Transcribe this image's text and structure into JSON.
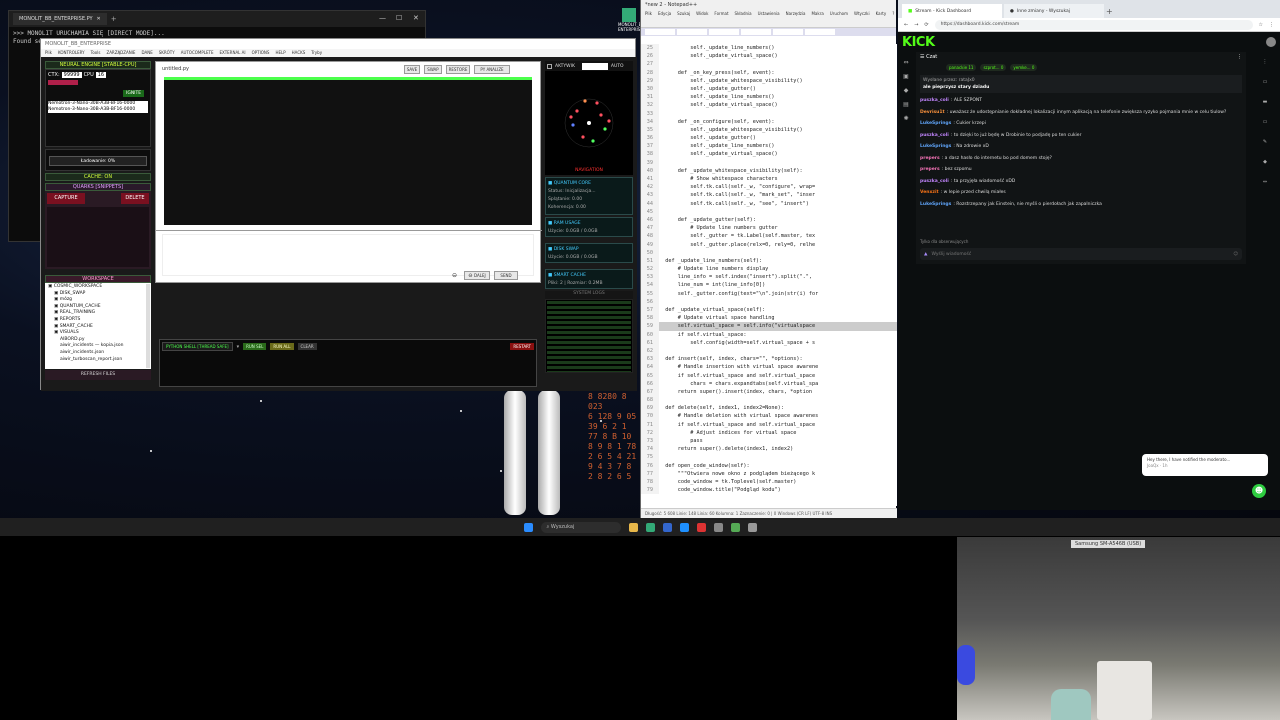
{
  "terminal": {
    "tab_title": "MONOLIT_BB_ENTERPRISE.PY",
    "lines": [
      ">>> MONOLIT URUCHAMIA SIĘ [DIRECT MODE]...",
      "Found se..."
    ]
  },
  "desktop_label": "MONOLIT_BB\nENTERPRISE",
  "app": {
    "title": "MONOLIT_BB_ENTERPRISE",
    "menu": [
      "Plik",
      "KONTROLERY",
      "Tools",
      "ZARZĄDZANIE",
      "DANE",
      "SKRÓTY",
      "AUTOCOMPLETE",
      "EXTERNAL AI",
      "OPTIONS",
      "HELP",
      "HACKS",
      "Tryby"
    ],
    "left": {
      "engine_title": "NEURAL ENGINE [STABLE-CPU]",
      "ctx_label": "CTX:",
      "ctx_value": "99999",
      "cpu_label": "CPU",
      "cpu_value": "16",
      "ignite": "IGNITE",
      "models": [
        "Nemotron-3-Nano-30B-A3B-BF16-0000",
        "Nemotron-3-Nano-30B-A3B-BF16-0000"
      ],
      "loading": "Ładowanie: 0%",
      "cache": "CACHE: ON",
      "quarks": "QUARKS [SNIPPETS]",
      "capture": "CAPTURE",
      "delete": "DELETE",
      "workspace": "WORKSPACE",
      "tree": [
        "COSMIC_WORKSPACE",
        "DISK_SWAP",
        "mózg",
        "QUANTUM_CACHE",
        "REAL_TRAINING",
        "REPORTS",
        "SMART_CACHE",
        "VISUALS",
        "AIBORD.py",
        "aiwir_incidents — kopia.json",
        "aiwir_incidents.json",
        "aiwir_turboscan_report.json"
      ],
      "refresh": "REFRESH FILES"
    },
    "editor": {
      "filename": "untitled.py",
      "buttons": [
        "SAVE",
        "SWAP",
        "RESTORE",
        "PY ANALIZE"
      ],
      "dalej": "DALEJ",
      "send": "SEND"
    },
    "shell": {
      "title": "PYTHON SHELL [THREAD SAFE]",
      "buttons": [
        "RUN SEL",
        "RUN ALL",
        "CLEAR"
      ],
      "restart": "RESTART"
    },
    "right": {
      "active": "AKTYWIK",
      "auto": "AUTO",
      "label": "NAVIGATION",
      "quantum": "QUANTUM CORE",
      "status": "Status: Inicjalizacja...",
      "splatanie": "Splątanie: 0.00",
      "koherencja": "Koherencja: 0.00",
      "ram": "RAM USAGE",
      "ram_val": "Użycie: 0.0GB / 0.0GB",
      "disk": "DISK SWAP",
      "disk_val": "Użycie: 0.0GB / 0.0GB",
      "smart": "SMART CACHE",
      "smart_val": "Pliki: 2 | Rozmiar: 0.2MB",
      "logs": "SYSTEM LOGS"
    }
  },
  "notepad": {
    "title": "*new 2 - Notepad++",
    "menu": [
      "Plik",
      "Edycja",
      "Szukaj",
      "Widok",
      "Format",
      "Składnia",
      "Ustawienia",
      "Narzędzia",
      "Makra",
      "Uruchom",
      "Wtyczki",
      "Karty",
      "?"
    ],
    "lines": [
      {
        "n": "25",
        "t": "          self._update_line_numbers()"
      },
      {
        "n": "26",
        "t": "          self._update_virtual_space()"
      },
      {
        "n": "27",
        "t": ""
      },
      {
        "n": "28",
        "t": "      def _on_key_press(self, event):"
      },
      {
        "n": "29",
        "t": "          self._update_whitespace_visibility()"
      },
      {
        "n": "30",
        "t": "          self._update_gutter()"
      },
      {
        "n": "31",
        "t": "          self._update_line_numbers()"
      },
      {
        "n": "32",
        "t": "          self._update_virtual_space()"
      },
      {
        "n": "33",
        "t": ""
      },
      {
        "n": "34",
        "t": "      def _on_configure(self, event):"
      },
      {
        "n": "35",
        "t": "          self._update_whitespace_visibility()"
      },
      {
        "n": "36",
        "t": "          self._update_gutter()"
      },
      {
        "n": "37",
        "t": "          self._update_line_numbers()"
      },
      {
        "n": "38",
        "t": "          self._update_virtual_space()"
      },
      {
        "n": "39",
        "t": ""
      },
      {
        "n": "40",
        "t": "      def _update_whitespace_visibility(self):"
      },
      {
        "n": "41",
        "t": "          # Show whitespace characters"
      },
      {
        "n": "42",
        "t": "          self.tk.call(self._w, \"configure\", wrap="
      },
      {
        "n": "43",
        "t": "          self.tk.call(self._w, \"mark_set\", \"inser"
      },
      {
        "n": "44",
        "t": "          self.tk.call(self._w, \"see\", \"insert\")"
      },
      {
        "n": "45",
        "t": ""
      },
      {
        "n": "46",
        "t": "      def _update_gutter(self):"
      },
      {
        "n": "47",
        "t": "          # Update line numbers gutter"
      },
      {
        "n": "48",
        "t": "          self._gutter = tk.Label(self.master, tex"
      },
      {
        "n": "49",
        "t": "          self._gutter.place(relx=0, rely=0, relhe"
      },
      {
        "n": "50",
        "t": ""
      },
      {
        "n": "51",
        "t": "  def _update_line_numbers(self):"
      },
      {
        "n": "52",
        "t": "      # Update line numbers display"
      },
      {
        "n": "53",
        "t": "      line_info = self.index(\"insert\").split(\".\","
      },
      {
        "n": "54",
        "t": "      line_num = int(line_info[0])"
      },
      {
        "n": "55",
        "t": "      self._gutter.config(text=\"\\n\".join(str(i) for"
      },
      {
        "n": "56",
        "t": ""
      },
      {
        "n": "57",
        "t": "  def _update_virtual_space(self):"
      },
      {
        "n": "58",
        "t": "      # Update virtual space handling"
      },
      {
        "n": "59",
        "t": "      self.virtual_space = self.info(\"virtualspace"
      },
      {
        "n": "60",
        "t": "      if self.virtual_space:"
      },
      {
        "n": "61",
        "t": "          self.config(width=self.virtual_space + s"
      },
      {
        "n": "62",
        "t": ""
      },
      {
        "n": "63",
        "t": "  def insert(self, index, chars=\"\", *options):"
      },
      {
        "n": "64",
        "t": "      # Handle insertion with virtual space awarene"
      },
      {
        "n": "65",
        "t": "      if self.virtual_space and self.virtual_space"
      },
      {
        "n": "66",
        "t": "          chars = chars.expandtabs(self.virtual_spa"
      },
      {
        "n": "67",
        "t": "      return super().insert(index, chars, *option"
      },
      {
        "n": "68",
        "t": ""
      },
      {
        "n": "69",
        "t": "  def delete(self, index1, index2=None):"
      },
      {
        "n": "70",
        "t": "      # Handle deletion with virtual space awarenes"
      },
      {
        "n": "71",
        "t": "      if self.virtual_space and self.virtual_space"
      },
      {
        "n": "72",
        "t": "          # Adjust indices for virtual space"
      },
      {
        "n": "73",
        "t": "          pass"
      },
      {
        "n": "74",
        "t": "      return super().delete(index1, index2)"
      },
      {
        "n": "75",
        "t": ""
      },
      {
        "n": "76",
        "t": "  def open_code_window(self):"
      },
      {
        "n": "77",
        "t": "      \"\"\"Otwiera nowe okno z podglądem bieżącego k"
      },
      {
        "n": "78",
        "t": "      code_window = tk.Toplevel(self.master)"
      },
      {
        "n": "79",
        "t": "      code_window.title(\"Podgląd kodu\")"
      }
    ],
    "status": "Długość: 5 608   Linie: 148   Linia: 60   Kolumna: 1   Zaznaczenie: 0 | 0     Windows (CR LF)   UTF-8   INS"
  },
  "browser": {
    "tabs": [
      "Stream - Kick Dashboard",
      "Inne zmiany - Wyszukaj"
    ],
    "url": "https://dashboard.kick.com/stream",
    "chat_title": "Czat",
    "pills": [
      "panackie 11",
      "szprot... 0",
      "yemke... 0"
    ],
    "pinned_by": "Wysłane przez: rataJx0",
    "pinned_msg": "ale pieprzysz stary dziadu",
    "messages": [
      {
        "user": "puszka_coli",
        "color": "#c084fc",
        "text": "ALE SZPONT"
      },
      {
        "user": "Devrisu1t",
        "color": "#fb923c",
        "text": "uważasz że udostępnianie dokładnej lokalizacji innym aplikacją na telefonie zwiększa ryzyko pojmania mnie w celu tiulow?"
      },
      {
        "user": "LukeSprings",
        "color": "#60a5fa",
        "text": "Cukier krzepi"
      },
      {
        "user": "puszka_coli",
        "color": "#c084fc",
        "text": "to dzięki to już będę w Drobinie to podjadę po ten cukier"
      },
      {
        "user": "LukeSprings",
        "color": "#60a5fa",
        "text": "Na zdrowie xD"
      },
      {
        "user": "prepers",
        "color": "#f472b6",
        "text": "a dasz hasło do internetu bo pod domem stoję?"
      },
      {
        "user": "prepers",
        "color": "#f472b6",
        "text": "bez szpomu"
      },
      {
        "user": "puszka_coli",
        "color": "#c084fc",
        "text": "ta przyjęła wiadomość xDD"
      },
      {
        "user": "Venxzit",
        "color": "#f97316",
        "text": "w lepie przed chwilą miałes"
      },
      {
        "user": "LukeSprings",
        "color": "#60a5fa",
        "text": "Rozstrzepany jak Einstein, nie myśli o pierdołach jak zapalniczka"
      }
    ],
    "followers_only": "Tylko dla obserwujących",
    "input_placeholder": "Wyślij wiadomość",
    "toast": "Hey there, I have notified the moderato...",
    "toast_sub": "JoaQx · 1h"
  },
  "taskbar": {
    "search": "Wyszukaj"
  },
  "camera": {
    "device": "Samsung SM-A546B (USB)"
  }
}
